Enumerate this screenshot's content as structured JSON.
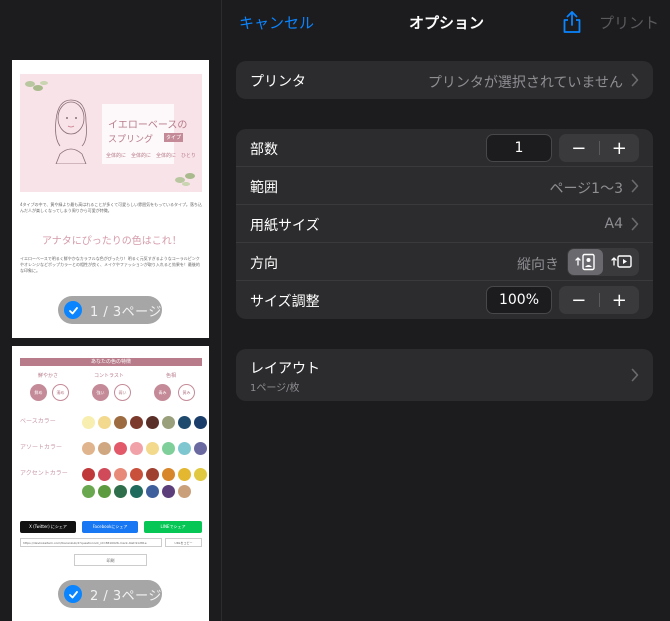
{
  "navbar": {
    "cancel_label": "キャンセル",
    "title": "オプション",
    "share_icon": "share-icon",
    "print_label": "プリント"
  },
  "printer": {
    "label": "プリンタ",
    "value": "プリンタが選択されていません"
  },
  "copies": {
    "label": "部数",
    "value": "1",
    "minus": "−",
    "plus": "+"
  },
  "range": {
    "label": "範囲",
    "value": "ページ1〜3"
  },
  "paper_size": {
    "label": "用紙サイズ",
    "value": "A4"
  },
  "orientation": {
    "label": "方向",
    "value": "縦向き",
    "options": [
      "portrait",
      "landscape"
    ],
    "selected": "portrait"
  },
  "scaling": {
    "label": "サイズ調整",
    "value": "100%",
    "minus": "−",
    "plus": "+"
  },
  "layout": {
    "label": "レイアウト",
    "value": "1ページ/枚"
  },
  "previews": [
    {
      "badge": "1 / 3ページ",
      "selected": true,
      "hero_title": "イエローベースの",
      "hero_title2": "スプリング",
      "hero_tag": "タイプ",
      "hero_sub": "全体的に　全体的に　全体的に　ひとり",
      "intro": "4タイプの中で、黄や緑より最も高はれることが多くて可愛らしい雰囲気をもっているタイプ。落ち込んだ人が楽しくなってしまう周りから可愛が特徴。",
      "subhead": "アナタにぴったりの色はこれ！",
      "body": "イエローベースで明るく鮮やかなカラフルな色がぴったり！明るく元気すぎるようなコーラルピンクやオレンジなどポップカラーとの相性が良く、メイクやファッションが取り入れると効果を！最後的な印象に。"
    },
    {
      "badge": "2 / 3ページ",
      "selected": true,
      "header": "あなたの色の特徴",
      "col1": "鮮やかさ",
      "col2": "コントラスト",
      "col3": "色相",
      "c1a": "鮮め",
      "c1b": "濁め",
      "c2a": "強い",
      "c2b": "弱い",
      "c3a": "青み",
      "c3b": "黄み",
      "row1": "ベースカラー",
      "row2": "アソートカラー",
      "row3": "アクセントカラー",
      "share_x": "X (Twitter) にシェア",
      "share_fb": "Facebookにシェア",
      "share_line": "LINEでシェア",
      "url": "https://devkozaitem.com/lbarankub/2?questionnot_id=8810026-mark-4lef-91281e",
      "copy": "URLをコピー",
      "print": "印刷"
    }
  ],
  "swatches": {
    "row1": [
      "#f8eeb0",
      "#f3d98e",
      "#9c6b3f",
      "#7b3a2c",
      "#5a2f28",
      "#9aa07c",
      "#1e4a6e",
      "#1a3d6a"
    ],
    "row2": [
      "#e0b58e",
      "#cfa882",
      "#e25a6a",
      "#f1a2a8",
      "#f2d98c",
      "#7fcf9a",
      "#7fc7d0",
      "#6b6aa0"
    ],
    "row3": [
      "#c0393a",
      "#d04a5a",
      "#e88a7a",
      "#c9503a",
      "#a04030",
      "#d8862a",
      "#e3b730",
      "#e0c840"
    ],
    "row4": [
      "#6aa84f",
      "#5c9b40",
      "#2e6e4a",
      "#1f6b5e",
      "#3e5f9b",
      "#5b3e7a",
      "#c9a07a"
    ]
  },
  "colors": {
    "accent": "#0a84ff",
    "background": "#1c1c1e",
    "cell": "#2c2c2e",
    "secondary_text": "#8e8e93",
    "disabled": "#5a5a5e"
  }
}
